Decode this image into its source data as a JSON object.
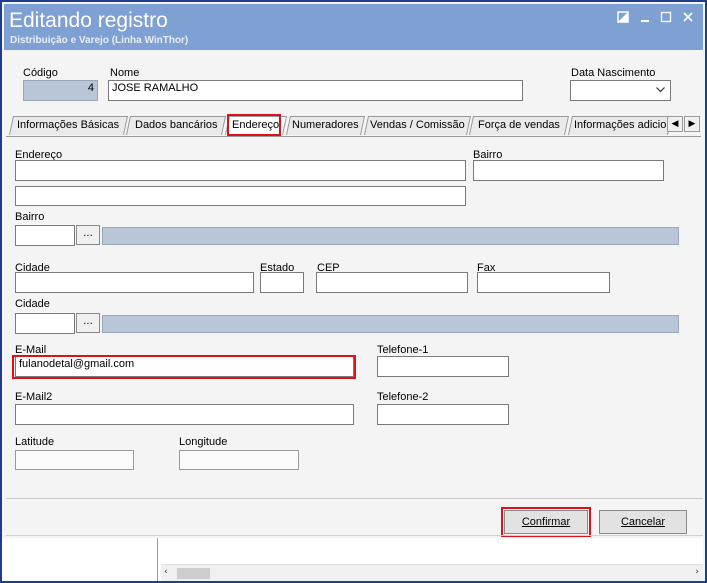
{
  "window": {
    "title": "Editando registro",
    "subtitle": "Distribuição e Varejo (Linha WinThor)",
    "controls": {
      "restore_icon": "restore-icon",
      "min_icon": "minimize-icon",
      "max_icon": "maximize-icon",
      "close_icon": "close-icon"
    }
  },
  "header": {
    "codigo_label": "Código",
    "codigo_value": "4",
    "nome_label": "Nome",
    "nome_value": "JOSE RAMALHO",
    "nascimento_label": "Data Nascimento",
    "nascimento_value": ""
  },
  "tabs": [
    {
      "label": "Informações Básicas"
    },
    {
      "label": "Dados bancários"
    },
    {
      "label": "Endereço"
    },
    {
      "label": "Numeradores"
    },
    {
      "label": "Vendas  / Comissão"
    },
    {
      "label": "Força de vendas"
    },
    {
      "label": "Informações adicio"
    }
  ],
  "form": {
    "endereco_label": "Endereço",
    "bairro_label_right": "Bairro",
    "bairro_label": "Bairro",
    "cidade_label": "Cidade",
    "estado_label": "Estado",
    "cep_label": "CEP",
    "fax_label": "Fax",
    "cidade2_label": "Cidade",
    "email_label": "E-Mail",
    "email_value": "fulanodetal@gmail.com",
    "telefone1_label": "Telefone-1",
    "email2_label": "E-Mail2",
    "telefone2_label": "Telefone-2",
    "latitude_label": "Latitude",
    "longitude_label": "Longitude",
    "dots": "..."
  },
  "buttons": {
    "confirm": "Confirmar",
    "cancel": "Cancelar"
  },
  "colors": {
    "titlebar": "#7ea0d3",
    "highlight": "#e0101a",
    "readonly_field": "#b8c6d7"
  }
}
